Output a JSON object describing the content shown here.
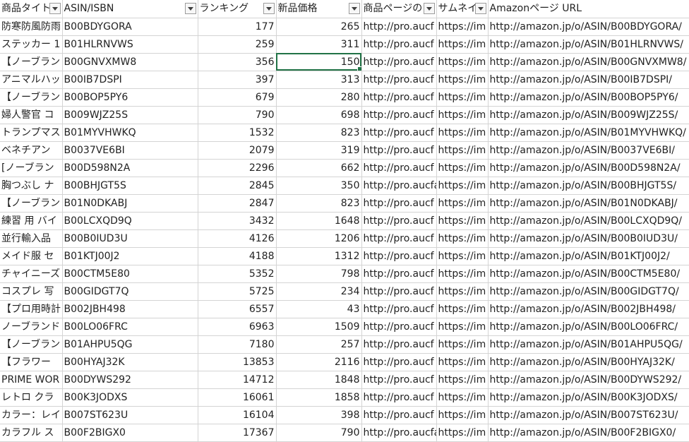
{
  "columns": [
    {
      "key": "title",
      "label": "商品タイト"
    },
    {
      "key": "asin",
      "label": "ASIN/ISBN"
    },
    {
      "key": "rank",
      "label": "ランキング"
    },
    {
      "key": "price",
      "label": "新品価格"
    },
    {
      "key": "page",
      "label": "商品ページの"
    },
    {
      "key": "thumb",
      "label": "サムネイ"
    },
    {
      "key": "amazon",
      "label": "Amazonページ URL"
    }
  ],
  "rows": [
    {
      "title": "防寒防風防雨",
      "asin": "B00BDYGORA",
      "rank": "177",
      "price": "265",
      "page": "http://pro.aucf",
      "thumb": "https://im",
      "amazon": "http://amazon.jp/o/ASIN/B00BDYGORA/"
    },
    {
      "title": "ステッカー 1",
      "asin": "B01HLRNVWS",
      "rank": "259",
      "price": "311",
      "page": "http://pro.aucf",
      "thumb": "https://im",
      "amazon": "http://amazon.jp/o/ASIN/B01HLRNVWS/"
    },
    {
      "title": "【ノーブラン",
      "asin": "B00GNVXMW8",
      "rank": "356",
      "price": "150",
      "page": "http://pro.aucf",
      "thumb": "https://im",
      "amazon": "http://amazon.jp/o/ASIN/B00GNVXMW8/"
    },
    {
      "title": "アニマルハッ",
      "asin": "B00IB7DSPI",
      "rank": "397",
      "price": "313",
      "page": "http://pro.aucf",
      "thumb": "https://im",
      "amazon": "http://amazon.jp/o/ASIN/B00IB7DSPI/"
    },
    {
      "title": "【ノーブラン",
      "asin": "B00BOP5PY6",
      "rank": "679",
      "price": "280",
      "page": "http://pro.aucf",
      "thumb": "https://im",
      "amazon": "http://amazon.jp/o/ASIN/B00BOP5PY6/"
    },
    {
      "title": "婦人警官 コ",
      "asin": "B009WJZ25S",
      "rank": "790",
      "price": "698",
      "page": "http://pro.aucf",
      "thumb": "https://im",
      "amazon": "http://amazon.jp/o/ASIN/B009WJZ25S/"
    },
    {
      "title": "トランプマス",
      "asin": "B01MYVHWKQ",
      "rank": "1532",
      "price": "823",
      "page": "http://pro.aucf",
      "thumb": "https://im",
      "amazon": "http://amazon.jp/o/ASIN/B01MYVHWKQ/"
    },
    {
      "title": "ベネチアン",
      "asin": "B0037VE6BI",
      "rank": "2079",
      "price": "319",
      "page": "http://pro.aucf",
      "thumb": "https://im",
      "amazon": "http://amazon.jp/o/ASIN/B0037VE6BI/"
    },
    {
      "title": "[ノーブラン",
      "asin": "B00D598N2A",
      "rank": "2296",
      "price": "662",
      "page": "http://pro.aucf",
      "thumb": "https://im",
      "amazon": "http://amazon.jp/o/ASIN/B00D598N2A/"
    },
    {
      "title": "胸つぶし ナ",
      "asin": "B00BHJGT5S",
      "rank": "2845",
      "price": "350",
      "page": "http://pro.aucfan.com/an",
      "thumb": "https://im",
      "amazon": "http://amazon.jp/o/ASIN/B00BHJGT5S/"
    },
    {
      "title": "【ノーブラン",
      "asin": "B01N0DKABJ",
      "rank": "2847",
      "price": "823",
      "page": "http://pro.aucf",
      "thumb": "https://im",
      "amazon": "http://amazon.jp/o/ASIN/B01N0DKABJ/"
    },
    {
      "title": "練習 用 バイ",
      "asin": "B00LCXQD9Q",
      "rank": "3432",
      "price": "1648",
      "page": "http://pro.aucf",
      "thumb": "https://im",
      "amazon": "http://amazon.jp/o/ASIN/B00LCXQD9Q/"
    },
    {
      "title": "並行輸入品",
      "asin": "B00B0IUD3U",
      "rank": "4126",
      "price": "1206",
      "page": "http://pro.aucf",
      "thumb": "https://im",
      "amazon": "http://amazon.jp/o/ASIN/B00B0IUD3U/"
    },
    {
      "title": "メイド服 セ",
      "asin": "B01KTJ00J2",
      "rank": "4188",
      "price": "1312",
      "page": "http://pro.aucf",
      "thumb": "https://im",
      "amazon": "http://amazon.jp/o/ASIN/B01KTJ00J2/"
    },
    {
      "title": "チャイニーズ",
      "asin": "B00CTM5E80",
      "rank": "5352",
      "price": "798",
      "page": "http://pro.aucf",
      "thumb": "https://im",
      "amazon": "http://amazon.jp/o/ASIN/B00CTM5E80/"
    },
    {
      "title": "コスプレ 写",
      "asin": "B00GIDGT7Q",
      "rank": "5725",
      "price": "234",
      "page": "http://pro.aucf",
      "thumb": "https://im",
      "amazon": "http://amazon.jp/o/ASIN/B00GIDGT7Q/"
    },
    {
      "title": "【プロ用時計",
      "asin": "B002JBH498",
      "rank": "6557",
      "price": "43",
      "page": "http://pro.aucf",
      "thumb": "https://im",
      "amazon": "http://amazon.jp/o/ASIN/B002JBH498/"
    },
    {
      "title": "ノーブランド",
      "asin": "B00LO06FRC",
      "rank": "6963",
      "price": "1509",
      "page": "http://pro.aucf",
      "thumb": "https://im",
      "amazon": "http://amazon.jp/o/ASIN/B00LO06FRC/"
    },
    {
      "title": "【ノーブラン",
      "asin": "B01AHPU5QG",
      "rank": "7180",
      "price": "257",
      "page": "http://pro.aucf",
      "thumb": "https://im",
      "amazon": "http://amazon.jp/o/ASIN/B01AHPU5QG/"
    },
    {
      "title": "【フラワー",
      "asin": "B00HYAJ32K",
      "rank": "13853",
      "price": "2116",
      "page": "http://pro.aucf",
      "thumb": "https://im",
      "amazon": "http://amazon.jp/o/ASIN/B00HYAJ32K/"
    },
    {
      "title": "PRIME WOR",
      "asin": "B00DYWS292",
      "rank": "14712",
      "price": "1848",
      "page": "http://pro.aucf",
      "thumb": "https://im",
      "amazon": "http://amazon.jp/o/ASIN/B00DYWS292/"
    },
    {
      "title": "レトロ クラ",
      "asin": "B00K3JODXS",
      "rank": "16061",
      "price": "1858",
      "page": "http://pro.aucf",
      "thumb": "https://im",
      "amazon": "http://amazon.jp/o/ASIN/B00K3JODXS/"
    },
    {
      "title": "カラー：レイ",
      "asin": "B007ST623U",
      "rank": "16104",
      "price": "398",
      "page": "http://pro.aucf",
      "thumb": "https://im",
      "amazon": "http://amazon.jp/o/ASIN/B007ST623U/"
    },
    {
      "title": "カラフル ス",
      "asin": "B00F2BIGX0",
      "rank": "17367",
      "price": "790",
      "page": "http://pro.aucfan.com/an",
      "thumb": "https://im",
      "amazon": "http://amazon.jp/o/ASIN/B00F2BIGX0/"
    }
  ],
  "icons": {
    "filter": "dropdown-arrow-icon"
  },
  "colors": {
    "gridline": "#d4d4d4",
    "selection": "#217346"
  }
}
